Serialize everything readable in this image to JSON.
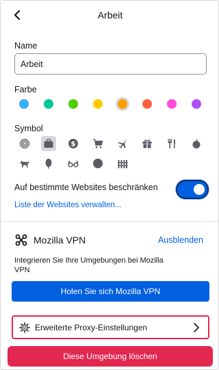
{
  "header": {
    "title": "Arbeit"
  },
  "name_section": {
    "label": "Name",
    "value": "Arbeit"
  },
  "color_section": {
    "label": "Farbe",
    "colors": [
      {
        "name": "blue",
        "hex": "#37adff"
      },
      {
        "name": "turquoise",
        "hex": "#00c79a"
      },
      {
        "name": "green",
        "hex": "#51cd00"
      },
      {
        "name": "yellow",
        "hex": "#ffcb00"
      },
      {
        "name": "orange",
        "hex": "#ff9f00",
        "selected": true
      },
      {
        "name": "red",
        "hex": "#ff613d"
      },
      {
        "name": "pink",
        "hex": "#ff4bda"
      },
      {
        "name": "purple",
        "hex": "#af51f5"
      }
    ]
  },
  "symbol_section": {
    "label": "Symbol",
    "icons": [
      "fingerprint-icon",
      "briefcase-icon",
      "dollar-icon",
      "cart-icon",
      "plane-icon",
      "gift-icon",
      "food-icon",
      "fruit-icon",
      "pet-icon",
      "tree-icon",
      "glasses-icon",
      "circle-icon",
      "fence-icon"
    ],
    "selected_icon": "briefcase-icon"
  },
  "restrict": {
    "label": "Auf bestimmte Websites beschränken",
    "enabled": true,
    "link": "Liste der Websites verwalten..."
  },
  "vpn": {
    "title": "Mozilla VPN",
    "hide_label": "Ausblenden",
    "description": "Integrieren Sie Ihre Umgebungen bei Mozilla VPN",
    "cta_label": "Holen Sie sich Mozilla VPN"
  },
  "proxy": {
    "label": "Erweiterte Proxy-Einstellungen"
  },
  "delete_label": "Diese Umgebung löschen",
  "theme": {
    "accent": "#0060df",
    "danger": "#e22850",
    "icon_color": "#5b5b66"
  }
}
